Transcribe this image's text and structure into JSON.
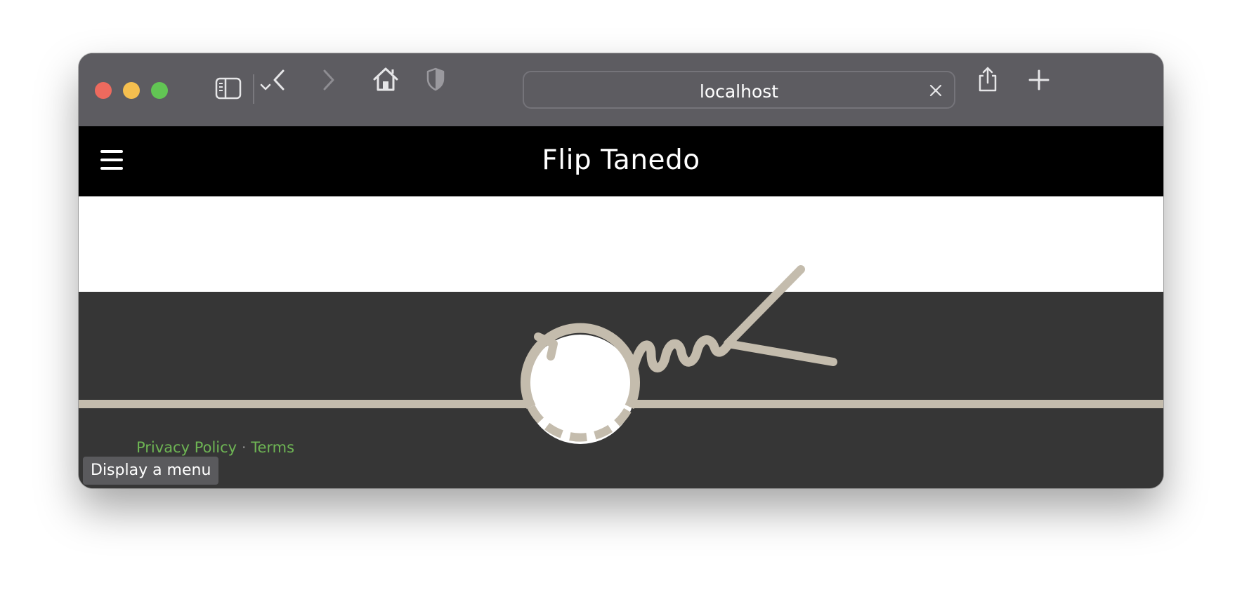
{
  "browser": {
    "url_text": "localhost",
    "icons": {
      "sidebar": "sidebar-icon",
      "chevron": "chevron-down-icon",
      "back": "back-arrow-icon",
      "forward": "forward-arrow-icon",
      "home": "home-icon",
      "privacy": "shield-icon",
      "clear": "close-icon",
      "share": "share-icon",
      "new_tab": "plus-icon"
    },
    "traffic_light_colors": [
      "#ed6a5e",
      "#f5bf4f",
      "#62c554"
    ]
  },
  "site": {
    "title": "Flip Tanedo",
    "menu_icon": "hamburger-menu-icon",
    "illustration": "feynman-diagram-graphic"
  },
  "footer": {
    "privacy_link": "Privacy Policy",
    "separator": "·",
    "terms_link": "Terms"
  },
  "tooltip": {
    "text": "Display a menu"
  },
  "colors": {
    "link": "#6eb554",
    "header_bg": "#000000",
    "footer_bg": "#363636",
    "diagram_stroke": "#c4bcad"
  }
}
